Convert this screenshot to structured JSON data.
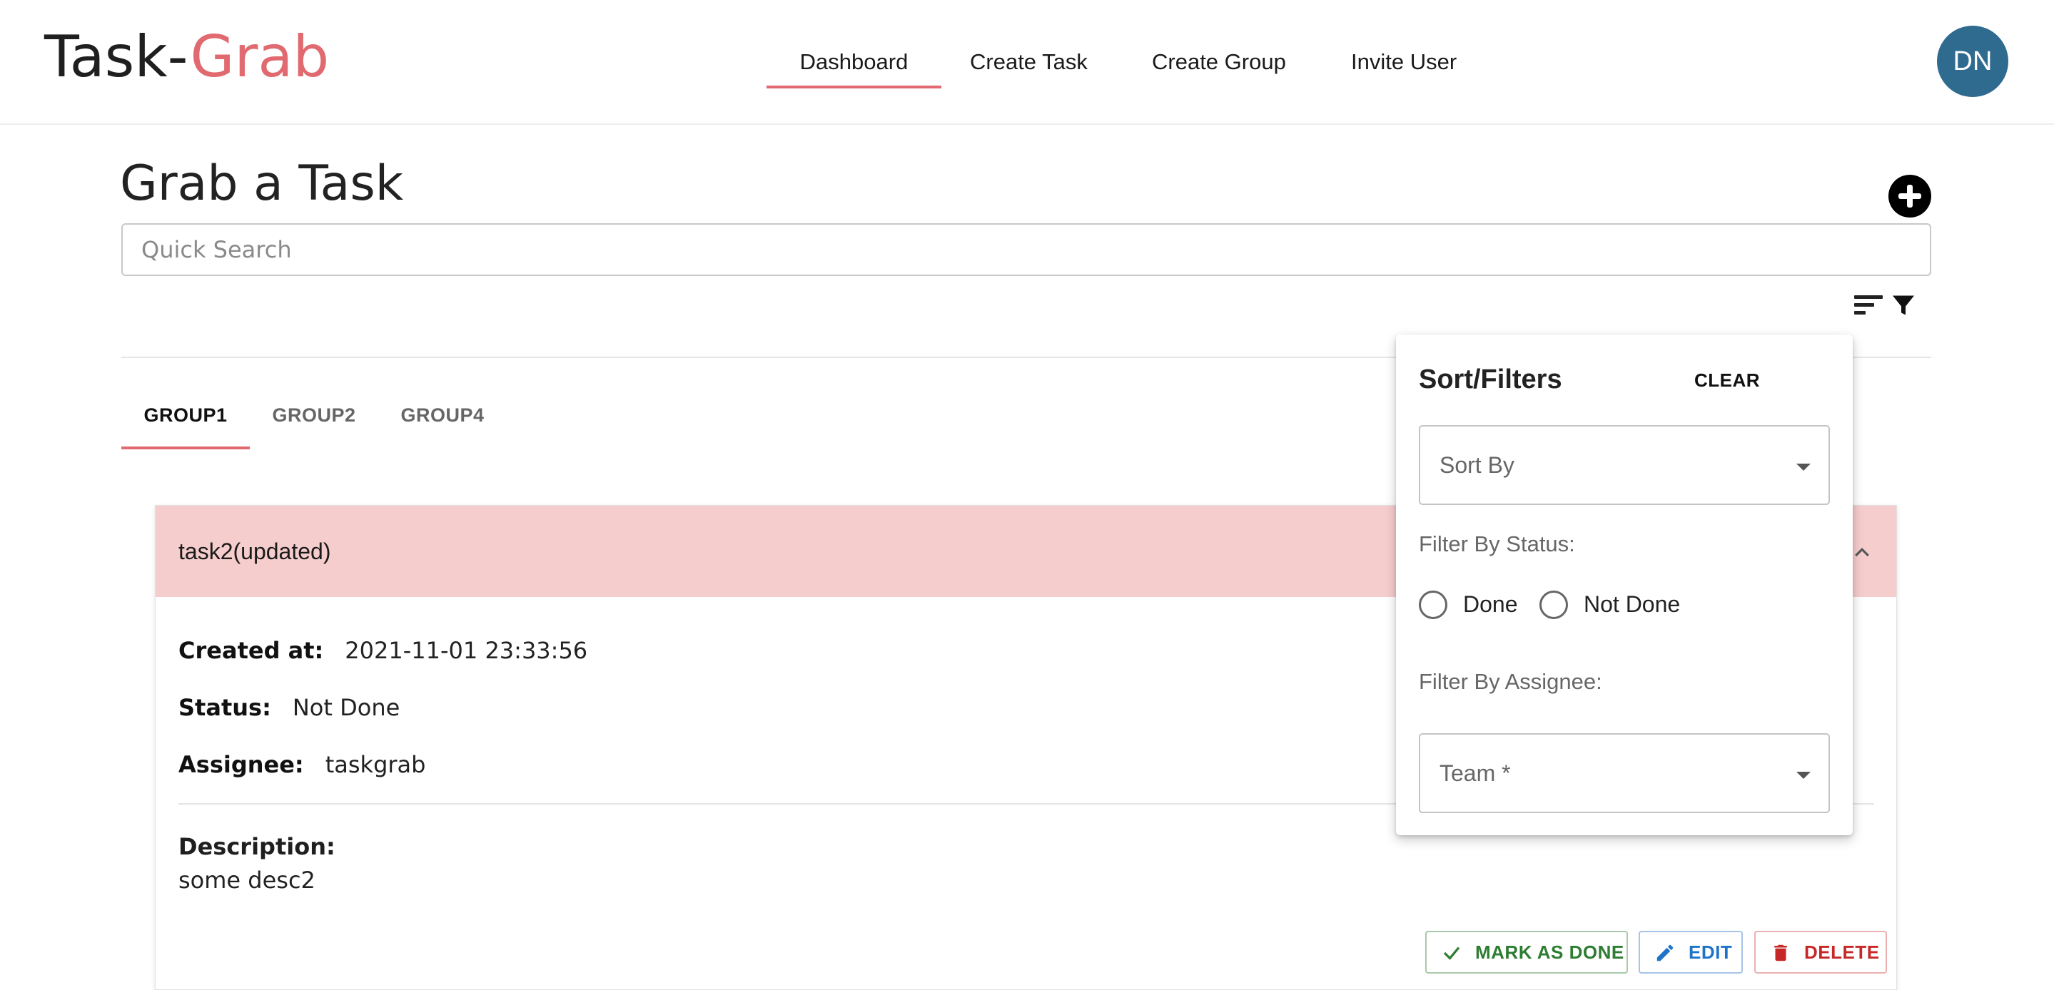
{
  "header": {
    "logo_part1": "Task-",
    "logo_part2": "Grab",
    "nav": [
      {
        "label": "Dashboard",
        "active": true
      },
      {
        "label": "Create Task",
        "active": false
      },
      {
        "label": "Create Group",
        "active": false
      },
      {
        "label": "Invite User",
        "active": false
      }
    ],
    "avatar_initials": "DN"
  },
  "page": {
    "title": "Grab a Task",
    "search_placeholder": "Quick Search",
    "add_icon": "plus-circle-icon",
    "sort_icon": "sort-icon",
    "filter_icon": "filter-icon"
  },
  "tabs": [
    {
      "label": "GROUP1",
      "active": true
    },
    {
      "label": "GROUP2",
      "active": false
    },
    {
      "label": "GROUP4",
      "active": false
    }
  ],
  "task": {
    "title": "task2(updated)",
    "created_label": "Created at:",
    "created_value": "2021-11-01 23:33:56",
    "status_label": "Status:",
    "status_value": "Not Done",
    "assignee_label": "Assignee:",
    "assignee_value": "taskgrab",
    "description_label": "Description:",
    "description_value": "some desc2",
    "buttons": {
      "mark_done": "MARK AS DONE",
      "edit": "EDIT",
      "delete": "DELETE"
    }
  },
  "sort_filters": {
    "title": "Sort/Filters",
    "clear": "CLEAR",
    "sort_by": "Sort By",
    "filter_status_label": "Filter By Status:",
    "status_options": [
      "Done",
      "Not Done"
    ],
    "filter_assignee_label": "Filter By Assignee:",
    "team_select": "Team *"
  },
  "colors": {
    "accent": "#e06a70",
    "task_header_bg": "#f6cdcd",
    "avatar_bg": "#2f6a8f",
    "success": "#2e7d32",
    "info": "#1e73c9",
    "danger": "#c62828"
  }
}
